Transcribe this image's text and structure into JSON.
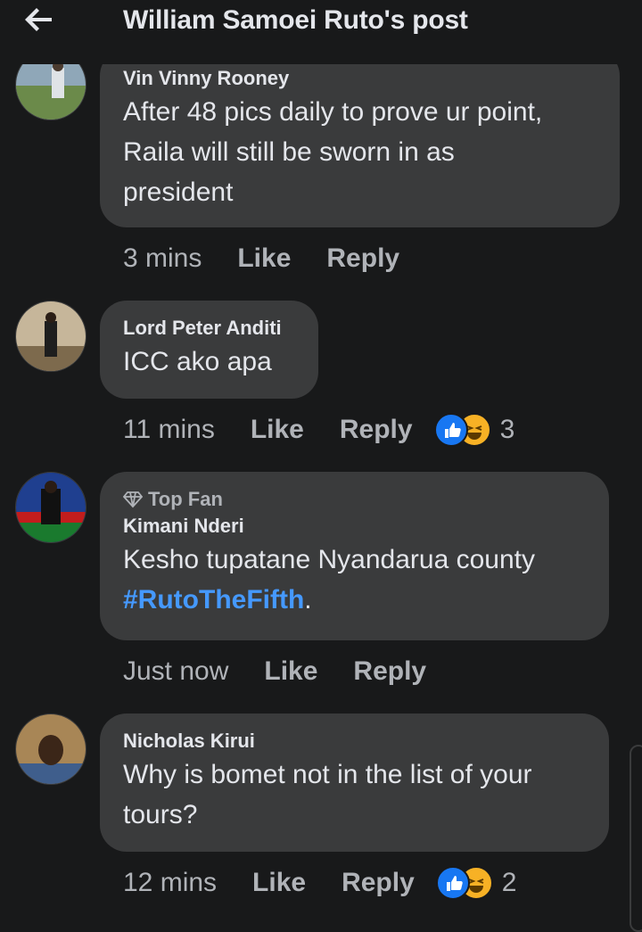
{
  "header": {
    "title": "William Samoei Ruto's post",
    "back_icon": "back-arrow-icon"
  },
  "comments": [
    {
      "author": "Vin Vinny Rooney",
      "text_lines": [
        "After 48 pics daily to prove ur point,",
        "Raila will still be sworn in as",
        "president"
      ],
      "time": "3 mins",
      "like_label": "Like",
      "reply_label": "Reply"
    },
    {
      "author": "Lord Peter Anditi",
      "text_lines": [
        "ICC ako apa"
      ],
      "time": "11 mins",
      "like_label": "Like",
      "reply_label": "Reply",
      "reactions": {
        "icons": [
          "like-reaction-icon",
          "haha-reaction-icon"
        ],
        "count": "3"
      }
    },
    {
      "badge": "Top Fan",
      "author": "Kimani Nderi",
      "text_lines": [
        "Kesho tupatane Nyandarua county"
      ],
      "hashtag": "#RutoTheFifth",
      "hashtag_suffix": ".",
      "time": "Just now",
      "like_label": "Like",
      "reply_label": "Reply"
    },
    {
      "author": "Nicholas Kirui",
      "text_lines": [
        "Why is bomet not in the list of your",
        "tours?"
      ],
      "time": "12 mins",
      "like_label": "Like",
      "reply_label": "Reply",
      "reactions": {
        "icons": [
          "like-reaction-icon",
          "haha-reaction-icon"
        ],
        "count": "2"
      }
    }
  ],
  "colors": {
    "background": "#18191a",
    "bubble": "#3a3b3c",
    "text": "#e4e6eb",
    "muted": "#b0b3b8",
    "hashtag": "#4599ff",
    "like_blue": "#1877f2",
    "haha_yellow": "#f7b125"
  }
}
